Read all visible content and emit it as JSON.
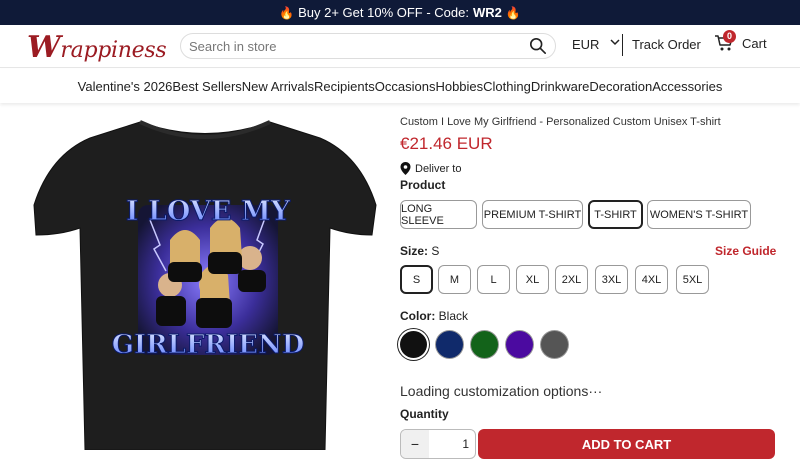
{
  "promo": {
    "prefix": "Buy 2+ Get 10% OFF - Code:",
    "code": "WR2",
    "icon": "fire-icon"
  },
  "header": {
    "logo_initial": "W",
    "logo_rest": "rappiness",
    "search_placeholder": "Search in store",
    "currency": "EUR",
    "track_order": "Track Order",
    "cart_label": "Cart",
    "cart_count": "0"
  },
  "nav": {
    "items": [
      "Valentine's 2026",
      "Best Sellers",
      "New Arrivals",
      "Recipients",
      "Occasions",
      "Hobbies",
      "Clothing",
      "Drinkware",
      "Decoration",
      "Accessories"
    ]
  },
  "product": {
    "title": "Custom I Love My Girlfriend - Personalized Custom Unisex T-shirt",
    "price": "€21.46 EUR",
    "deliver_to": "Deliver to",
    "image_text_top": "I LOVE MY",
    "image_text_bottom": "GIRLFRIEND",
    "product_label": "Product",
    "product_options": [
      "LONG SLEEVE",
      "PREMIUM T-SHIRT",
      "T-SHIRT",
      "WOMEN'S T-SHIRT"
    ],
    "product_selected": "T-SHIRT",
    "size_label": "Size:",
    "size_value": "S",
    "size_guide": "Size Guide",
    "sizes": [
      "S",
      "M",
      "L",
      "XL",
      "2XL",
      "3XL",
      "4XL",
      "5XL"
    ],
    "color_label": "Color:",
    "color_value": "Black",
    "colors": [
      "#111111",
      "#102a6b",
      "#13631a",
      "#4b0aa0",
      "#555555"
    ],
    "loading": "Loading customization options···",
    "quantity_label": "Quantity",
    "quantity_minus": "−",
    "quantity_value": "1",
    "add_to_cart": "ADD TO CART"
  },
  "colors": {
    "accent": "#c0272d",
    "promo_bg": "#0f1a38"
  }
}
